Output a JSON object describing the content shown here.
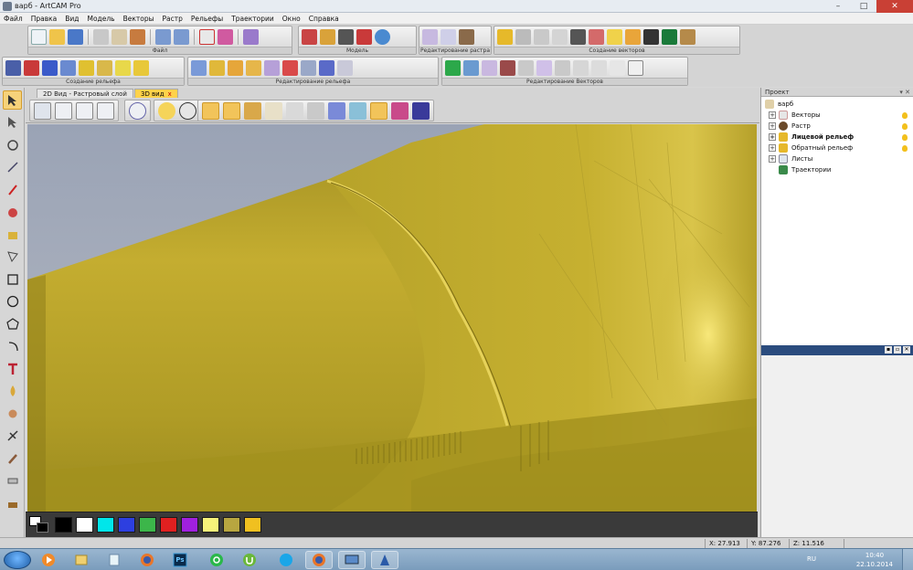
{
  "window": {
    "title": "варб - ArtCAM Pro",
    "minimize": "–",
    "maximize": "□",
    "close": "✕"
  },
  "menu": [
    "Файл",
    "Правка",
    "Вид",
    "Модель",
    "Векторы",
    "Растр",
    "Рельефы",
    "Траектории",
    "Окно",
    "Справка"
  ],
  "toolbar_groups": {
    "file": "Файл",
    "model": "Модель",
    "raster_edit": "Редактирование растра",
    "vector_create": "Создание векторов",
    "relief_create": "Создание рельефа",
    "relief_edit": "Редактирование рельефа",
    "vector_edit": "Редактирование Векторов"
  },
  "tabs": [
    {
      "label": "2D Вид - Растровый слой"
    },
    {
      "label": "3D вид",
      "close": "x"
    }
  ],
  "palette": {
    "colors": [
      "#000000",
      "#ffffff",
      "#00e6ea",
      "#2d3fe0",
      "#3cb64a",
      "#e02020",
      "#a020e0",
      "#f6f27a",
      "#b8a640",
      "#f0c020"
    ]
  },
  "project": {
    "title": "Проект",
    "header_buttons": "▾ ✕",
    "root": "варб",
    "items": [
      {
        "label": "Векторы",
        "expander": "+",
        "bold": false,
        "bulb": true,
        "icon": "vectors-icon"
      },
      {
        "label": "Растр",
        "expander": "+",
        "bold": false,
        "bulb": true,
        "icon": "raster-icon"
      },
      {
        "label": "Лицевой рельеф",
        "expander": "+",
        "bold": true,
        "bulb": true,
        "icon": "front-relief-icon"
      },
      {
        "label": "Обратный рельеф",
        "expander": "+",
        "bold": false,
        "bulb": true,
        "icon": "back-relief-icon"
      },
      {
        "label": "Листы",
        "expander": "+",
        "bold": false,
        "bulb": false,
        "icon": "sheets-icon"
      },
      {
        "label": "Траектории",
        "expander": "",
        "bold": false,
        "bulb": false,
        "icon": "toolpaths-icon"
      }
    ]
  },
  "panel2_buttons": [
    "▪",
    "▫",
    "✕"
  ],
  "status": {
    "x": "X: 27.913",
    "y": "Y: 87.276",
    "z": "Z: 11.516"
  },
  "taskbar": {
    "lang": "RU",
    "time": "10:40",
    "date": "22.10.2014",
    "ps_label": "Ps"
  },
  "colors": {
    "relief": "#c2ac2e",
    "relief_dark": "#8e7c14",
    "background": "#9fa6b5",
    "accent": "#f2c45a"
  }
}
